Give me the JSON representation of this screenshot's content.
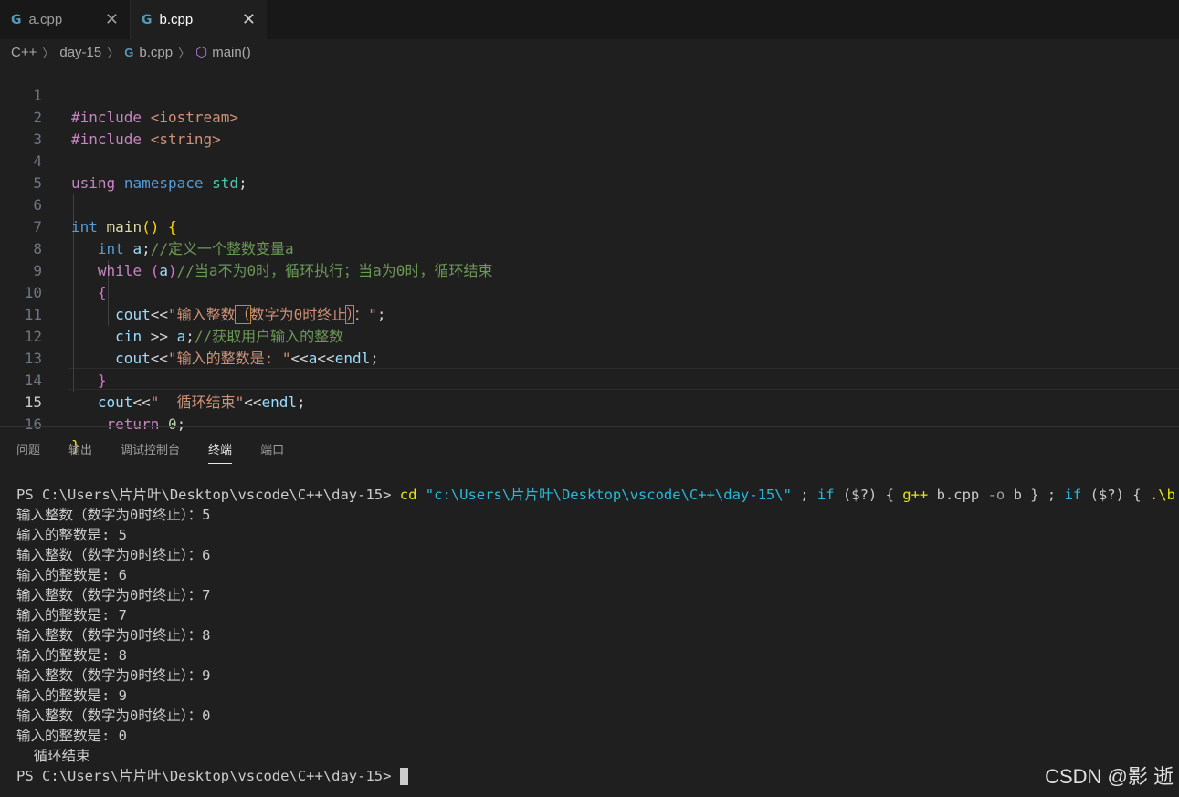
{
  "tabs": [
    {
      "label": "a.cpp",
      "active": false
    },
    {
      "label": "b.cpp",
      "active": true
    }
  ],
  "breadcrumb": {
    "items": [
      "C++",
      "day-15",
      "b.cpp",
      "main()"
    ]
  },
  "editor": {
    "line_numbers": [
      "1",
      "2",
      "3",
      "4",
      "5",
      "6",
      "7",
      "8",
      "9",
      "10",
      "11",
      "12",
      "13",
      "14",
      "15",
      "16"
    ],
    "current_line": "15",
    "code": {
      "l1_directive": "#include",
      "l1_header": "<iostream>",
      "l2_directive": "#include",
      "l2_header": "<string>",
      "l4_using": "using",
      "l4_namespace": "namespace",
      "l4_std": "std",
      "l4_semi": ";",
      "l6_int": "int",
      "l6_main": "main",
      "l6_parens": "()",
      "l6_brace": "{",
      "l7_int": "int",
      "l7_var": "a",
      "l7_semi": ";",
      "l7_comment": "//定义一个整数变量a",
      "l8_while": "while",
      "l8_open": "(",
      "l8_var": "a",
      "l8_close": ")",
      "l8_comment": "//当a不为0时，循环执行；当a为0时，循环结束",
      "l9_brace": "{",
      "l10_cout": "cout",
      "l10_op": "<<",
      "l10_str_a": "\"输入整数",
      "l10_lparen": "（",
      "l10_str_b": "数字为0时终止",
      "l10_rparen": "）",
      "l10_str_c": "：\"",
      "l10_semi": ";",
      "l11_cin": "cin",
      "l11_op": " >> ",
      "l11_var": "a",
      "l11_semi": ";",
      "l11_comment": "//获取用户输入的整数",
      "l12_cout": "cout",
      "l12_op1": "<<",
      "l12_str": "\"输入的整数是: \"",
      "l12_op2": "<<",
      "l12_var": "a",
      "l12_op3": "<<",
      "l12_endl": "endl",
      "l12_semi": ";",
      "l13_brace": "}",
      "l14_cout": "cout",
      "l14_op1": "<<",
      "l14_str": "\"  循环结束\"",
      "l14_op2": "<<",
      "l14_endl": "endl",
      "l14_semi": ";",
      "l15_return": "return",
      "l15_num": "0",
      "l15_semi": ";",
      "l16_brace": "}"
    }
  },
  "panel": {
    "tabs": [
      "问题",
      "输出",
      "调试控制台",
      "终端",
      "端口"
    ],
    "active_tab": "终端"
  },
  "terminal": {
    "prompt": "PS C:\\Users\\片片叶\\Desktop\\vscode\\C++\\day-15> ",
    "cmd_cd": "cd",
    "cmd_path": "\"c:\\Users\\片片叶\\Desktop\\vscode\\C++\\day-15\\\"",
    "cmd_sep1": " ; ",
    "cmd_if1": "if",
    "cmd_cond1": " ($?) ",
    "cmd_lb1": "{ ",
    "cmd_gpp": "g++",
    "cmd_args": " b.cpp ",
    "cmd_flag": "-o",
    "cmd_out": " b } ; ",
    "cmd_if2": "if",
    "cmd_cond2": " ($?) ",
    "cmd_lb2": "{ ",
    "cmd_run": ".\\b",
    "cmd_rb2": " }",
    "output": [
      "输入整数（数字为0时终止）：5",
      "输入的整数是: 5",
      "输入整数（数字为0时终止）：6",
      "输入的整数是: 6",
      "输入整数（数字为0时终止）：7",
      "输入的整数是: 7",
      "输入整数（数字为0时终止）：8",
      "输入的整数是: 8",
      "输入整数（数字为0时终止）：9",
      "输入的整数是: 9",
      "输入整数（数字为0时终止）：0",
      "输入的整数是: 0",
      "  循环结束"
    ],
    "final_prompt": "PS C:\\Users\\片片叶\\Desktop\\vscode\\C++\\day-15> "
  },
  "watermark": "CSDN @影 逝"
}
